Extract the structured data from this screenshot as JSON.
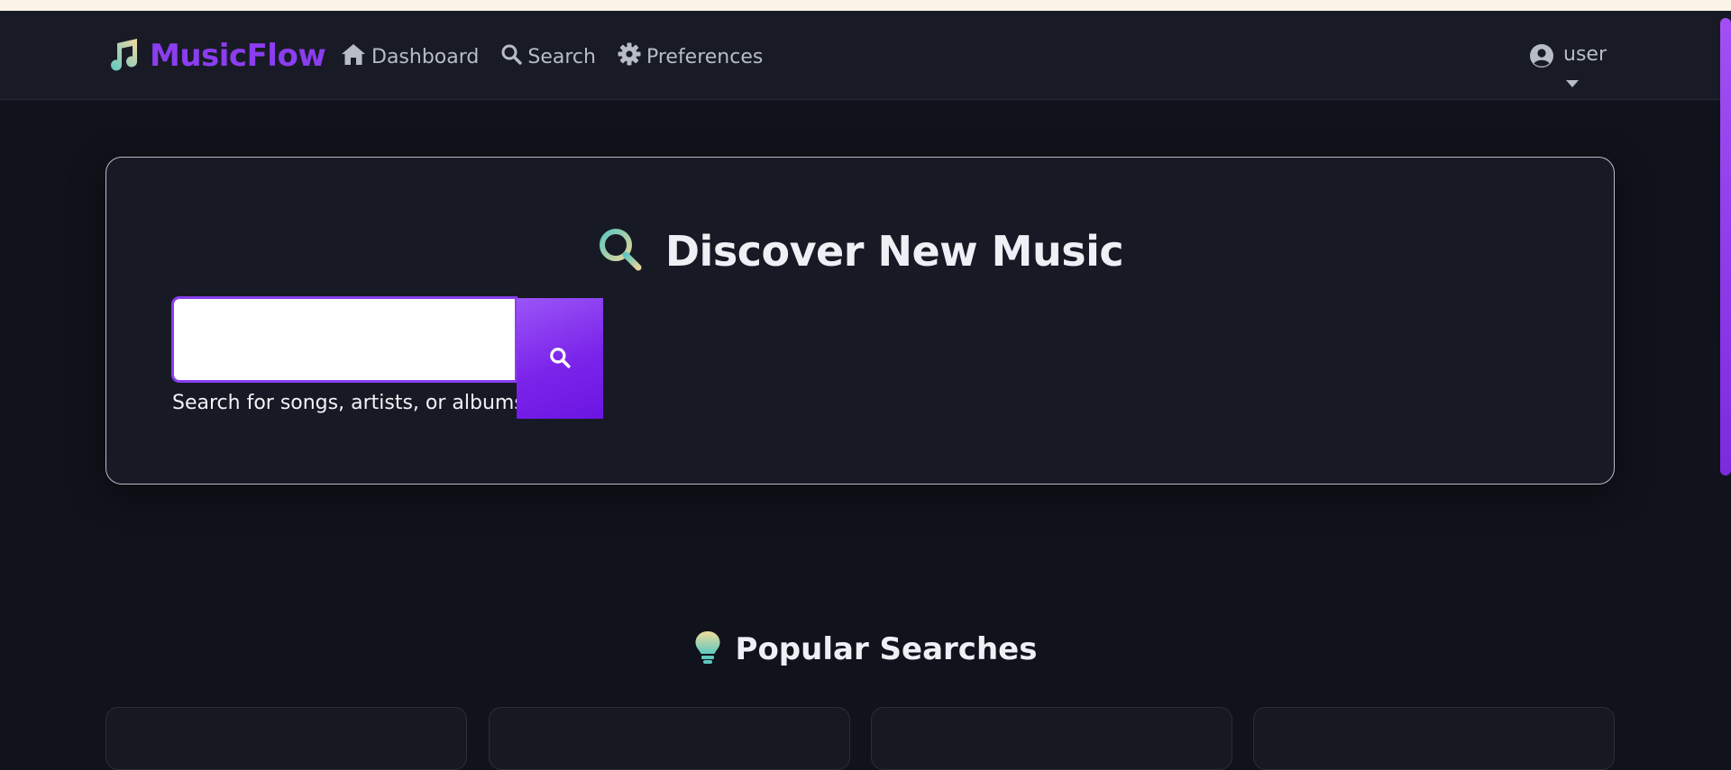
{
  "brand": {
    "name": "MusicFlow",
    "icon": "music-note-icon"
  },
  "nav": {
    "items": [
      {
        "label": "Dashboard",
        "icon": "home-icon"
      },
      {
        "label": "Search",
        "icon": "search-icon"
      },
      {
        "label": "Preferences",
        "icon": "gear-icon"
      }
    ]
  },
  "user_menu": {
    "label": "user",
    "icon": "user-circle-icon",
    "caret": "caret-down-icon"
  },
  "search": {
    "title": "Discover New Music",
    "title_icon": "magnifier-icon",
    "input_value": "",
    "hint": "Search for songs, artists, or albums...",
    "button_icon": "search-icon"
  },
  "popular": {
    "title": "Popular Searches",
    "icon": "lightbulb-icon",
    "cards_visible": 4
  },
  "colors": {
    "accent": "#8b3df0",
    "background": "#10131b",
    "navbar": "#181b25",
    "card": "#171a25",
    "teal": "#5ec8c0"
  }
}
